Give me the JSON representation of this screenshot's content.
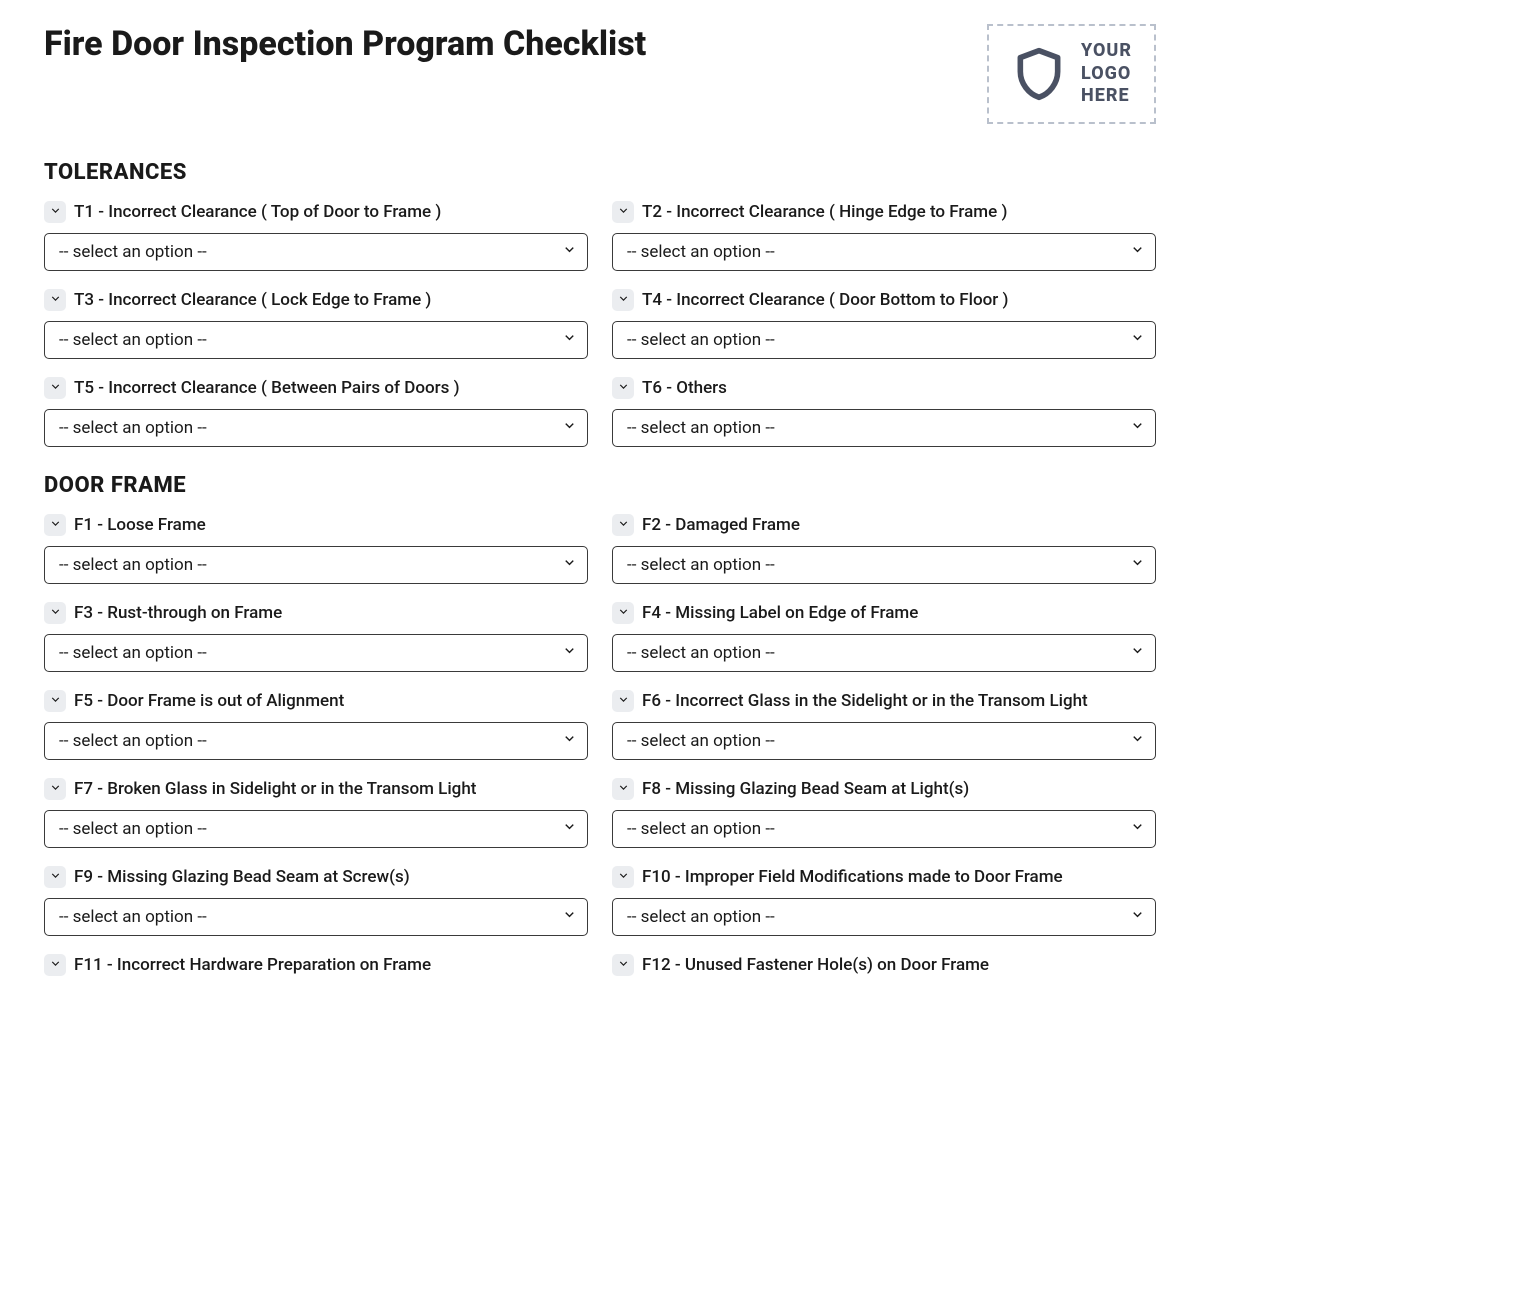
{
  "title": "Fire Door Inspection Program Checklist",
  "logo": {
    "line1": "YOUR",
    "line2": "LOGO",
    "line3": "HERE"
  },
  "select_placeholder": "-- select an option --",
  "sections": [
    {
      "heading": "TOLERANCES",
      "items": [
        {
          "label": "T1 - Incorrect Clearance ( Top of Door to Frame )"
        },
        {
          "label": "T2 - Incorrect Clearance ( Hinge Edge to Frame )"
        },
        {
          "label": "T3 - Incorrect Clearance ( Lock Edge to Frame )"
        },
        {
          "label": "T4 - Incorrect Clearance ( Door Bottom to Floor )"
        },
        {
          "label": "T5 - Incorrect Clearance ( Between Pairs of Doors )"
        },
        {
          "label": "T6 - Others"
        }
      ]
    },
    {
      "heading": "DOOR FRAME",
      "items": [
        {
          "label": "F1 - Loose Frame"
        },
        {
          "label": "F2 - Damaged Frame"
        },
        {
          "label": "F3 - Rust-through on Frame"
        },
        {
          "label": "F4 - Missing Label on Edge of Frame"
        },
        {
          "label": "F5 - Door Frame is out of Alignment"
        },
        {
          "label": "F6 - Incorrect Glass in the Sidelight or in the Transom Light"
        },
        {
          "label": "F7 - Broken Glass in Sidelight or in the Transom Light"
        },
        {
          "label": "F8 - Missing Glazing Bead Seam at Light(s)"
        },
        {
          "label": "F9 - Missing Glazing Bead Seam at Screw(s)"
        },
        {
          "label": "F10 - Improper Field Modifications made to Door Frame"
        },
        {
          "label": "F11 - Incorrect Hardware Preparation on Frame"
        },
        {
          "label": "F12 - Unused Fastener Hole(s) on Door Frame"
        }
      ]
    }
  ]
}
